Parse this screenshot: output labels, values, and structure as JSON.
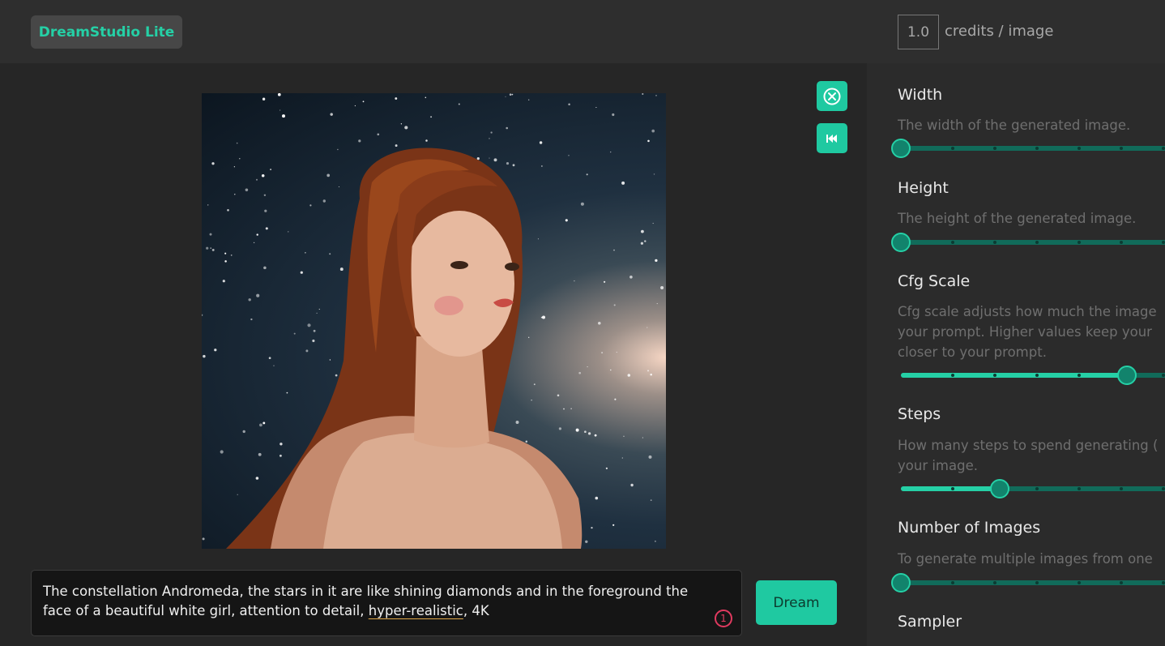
{
  "app": {
    "title": "DreamStudio Lite"
  },
  "header": {
    "credits_value": "1.0",
    "credits_label": "credits / image"
  },
  "image": {
    "alt": "Generated image: woman with auburn hair against a starry night sky"
  },
  "prompt": {
    "line1": "The constellation Andromeda, the stars in it are like shining diamonds and in the foreground the",
    "line2_before": "face of a beautiful white girl, attention to detail, ",
    "line2_underlined": "hyper-realistic",
    "line2_after": ", 4K",
    "issue_count": "1"
  },
  "buttons": {
    "dream": "Dream"
  },
  "settings": {
    "width": {
      "title": "Width",
      "desc": [
        "The width of the generated image."
      ],
      "level": 0.0
    },
    "height": {
      "title": "Height",
      "desc": [
        "The height of the generated image."
      ],
      "level": 0.0
    },
    "cfg": {
      "title": "Cfg Scale",
      "desc": [
        "Cfg scale adjusts how much the image",
        "your prompt. Higher values keep your",
        "closer to your prompt."
      ],
      "level": 0.82
    },
    "steps": {
      "title": "Steps",
      "desc": [
        "How many steps to spend generating (",
        "your image."
      ],
      "level": 0.36
    },
    "count": {
      "title": "Number of Images",
      "desc": [
        "To generate multiple images from one"
      ],
      "level": 0.0
    },
    "sampler": {
      "title": "Sampler"
    }
  },
  "colors": {
    "accent": "#1fc9a1",
    "track": "#116b5a",
    "background": "#262626",
    "panel": "#2b2b2b"
  }
}
